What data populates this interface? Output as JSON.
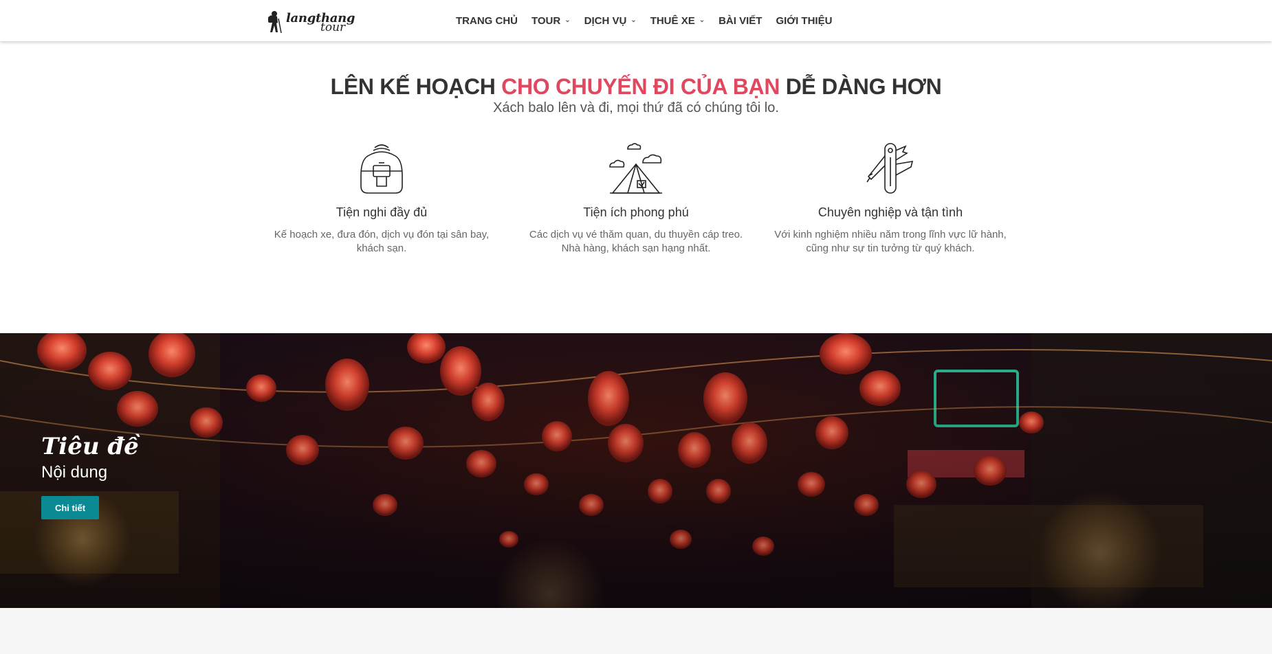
{
  "logo": {
    "line1": "langthang",
    "line2": "tour"
  },
  "nav": {
    "items": [
      {
        "label": "TRANG CHỦ",
        "dropdown": false
      },
      {
        "label": "TOUR",
        "dropdown": true
      },
      {
        "label": "DỊCH VỤ",
        "dropdown": true
      },
      {
        "label": "THUÊ XE",
        "dropdown": true
      },
      {
        "label": "BÀI VIẾT",
        "dropdown": false
      },
      {
        "label": "GIỚI THIỆU",
        "dropdown": false
      }
    ],
    "caret": "⌄"
  },
  "intro": {
    "headline_part1": "LÊN KẾ HOẠCH ",
    "headline_accent": "CHO CHUYẾN ĐI CỦA BẠN",
    "headline_part2": " DỄ DÀNG HƠN",
    "subheadline": "Xách balo lên và đi, mọi thứ đã có chúng tôi lo."
  },
  "features": [
    {
      "icon": "backpack-icon",
      "title": "Tiện nghi đầy đủ",
      "desc_line1": "Kế hoạch xe, đưa đón, dịch vụ đón tại sân bay,",
      "desc_line2": "khách sạn."
    },
    {
      "icon": "tent-icon",
      "title": "Tiện ích phong phú",
      "desc_line1": "Các dịch vụ vé thăm quan, du thuyền cáp treo.",
      "desc_line2": "Nhà hàng, khách sạn hạng nhất."
    },
    {
      "icon": "pocket-knife-icon",
      "title": "Chuyên nghiệp và tận tình",
      "desc_line1": "Với kinh nghiệm nhiều năm trong lĩnh vực lữ hành,",
      "desc_line2": "cũng như sự tin tưởng từ quý khách."
    }
  ],
  "banner": {
    "title": "Tiêu đề",
    "content": "Nội dung",
    "button_label": "Chi tiết",
    "button_color": "#0c8a94"
  },
  "colors": {
    "accent": "#e0485f",
    "text": "#333333"
  }
}
